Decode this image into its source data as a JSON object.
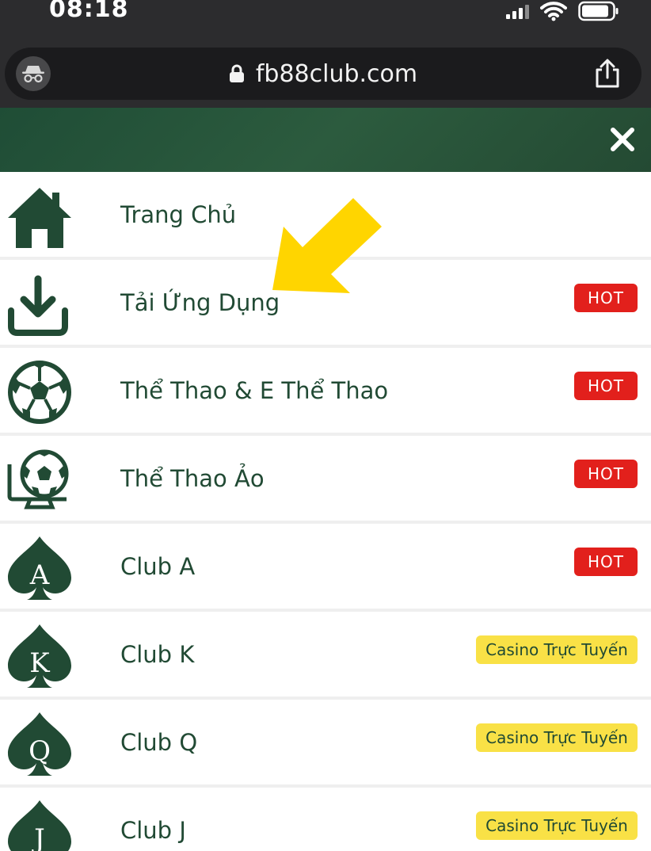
{
  "status": {
    "time": "08:18"
  },
  "browser": {
    "url": "fb88club.com"
  },
  "menu": {
    "items": [
      {
        "label": "Trang Chủ",
        "badge": ""
      },
      {
        "label": "Tải Ứng Dụng",
        "badge": "HOT"
      },
      {
        "label": "Thể Thao & E Thể Thao",
        "badge": "HOT"
      },
      {
        "label": "Thể Thao Ảo",
        "badge": "HOT"
      },
      {
        "label": "Club A",
        "badge": "HOT",
        "letter": "A"
      },
      {
        "label": "Club K",
        "badge": "Casino Trực Tuyến",
        "letter": "K"
      },
      {
        "label": "Club Q",
        "badge": "Casino Trực Tuyến",
        "letter": "Q"
      },
      {
        "label": "Club J",
        "badge": "Casino Trực Tuyến",
        "letter": "J"
      }
    ]
  },
  "colors": {
    "brand_green": "#214a34",
    "hot_red": "#e2201c",
    "casino_yellow": "#f9e146",
    "arrow_yellow": "#ffd500"
  },
  "icons": [
    "home-icon",
    "download-icon",
    "soccer-ball-icon",
    "virtual-soccer-icon",
    "spade-a-icon",
    "spade-k-icon",
    "spade-q-icon",
    "spade-j-icon"
  ]
}
